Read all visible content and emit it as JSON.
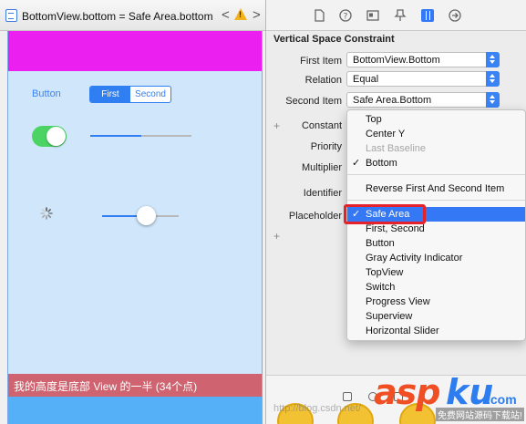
{
  "jumpbar": {
    "title": "BottomView.bottom = Safe Area.bottom",
    "back_glyph": "<",
    "forward_glyph": ">",
    "warning_glyph": "!"
  },
  "canvas": {
    "button_label": "Button",
    "segments": [
      "First",
      "Second"
    ],
    "bottom_view_text": "我的高度是底部 View 的一半 (34个点)",
    "switch_on": true,
    "progress_fraction": 0.5,
    "slider_fraction": 0.57
  },
  "inspector": {
    "section_title": "Vertical Space Constraint",
    "first_item_label": "First Item",
    "first_item_value": "BottomView.Bottom",
    "relation_label": "Relation",
    "relation_value": "Equal",
    "second_item_label": "Second Item",
    "second_item_value": "Safe Area.Bottom",
    "constant_label": "Constant",
    "priority_label": "Priority",
    "multiplier_label": "Multiplier",
    "identifier_label": "Identifier",
    "placeholder_label": "Placeholder",
    "plus_glyph": "+"
  },
  "menu": {
    "group1": [
      {
        "label": "Top",
        "checked": false,
        "disabled": false
      },
      {
        "label": "Center Y",
        "checked": false,
        "disabled": false
      },
      {
        "label": "Last Baseline",
        "checked": false,
        "disabled": true
      },
      {
        "label": "Bottom",
        "checked": true,
        "disabled": false
      }
    ],
    "reverse_label": "Reverse First And Second Item",
    "group2": [
      {
        "label": "Safe Area",
        "checked": true,
        "highlighted": true
      },
      {
        "label": "First, Second"
      },
      {
        "label": "Button"
      },
      {
        "label": "Gray Activity Indicator"
      },
      {
        "label": "TopView"
      },
      {
        "label": "Switch"
      },
      {
        "label": "Progress View"
      },
      {
        "label": "Superview"
      },
      {
        "label": "Horizontal Slider"
      }
    ],
    "check_glyph": "✓"
  },
  "watermark": {
    "asp": "asp",
    "ku": "ku",
    "com": ".com",
    "sub": "免费网站源码下载站!",
    "url": "http://blog.csdn.net/"
  },
  "colors": {
    "accent": "#3478f6",
    "magenta_bar": "#ea1ff0",
    "bottom_view": "#cf6370",
    "canvas_bg": "#cfe6fb",
    "switch_on": "#4bd463",
    "highlight_box": "#e5222b"
  }
}
